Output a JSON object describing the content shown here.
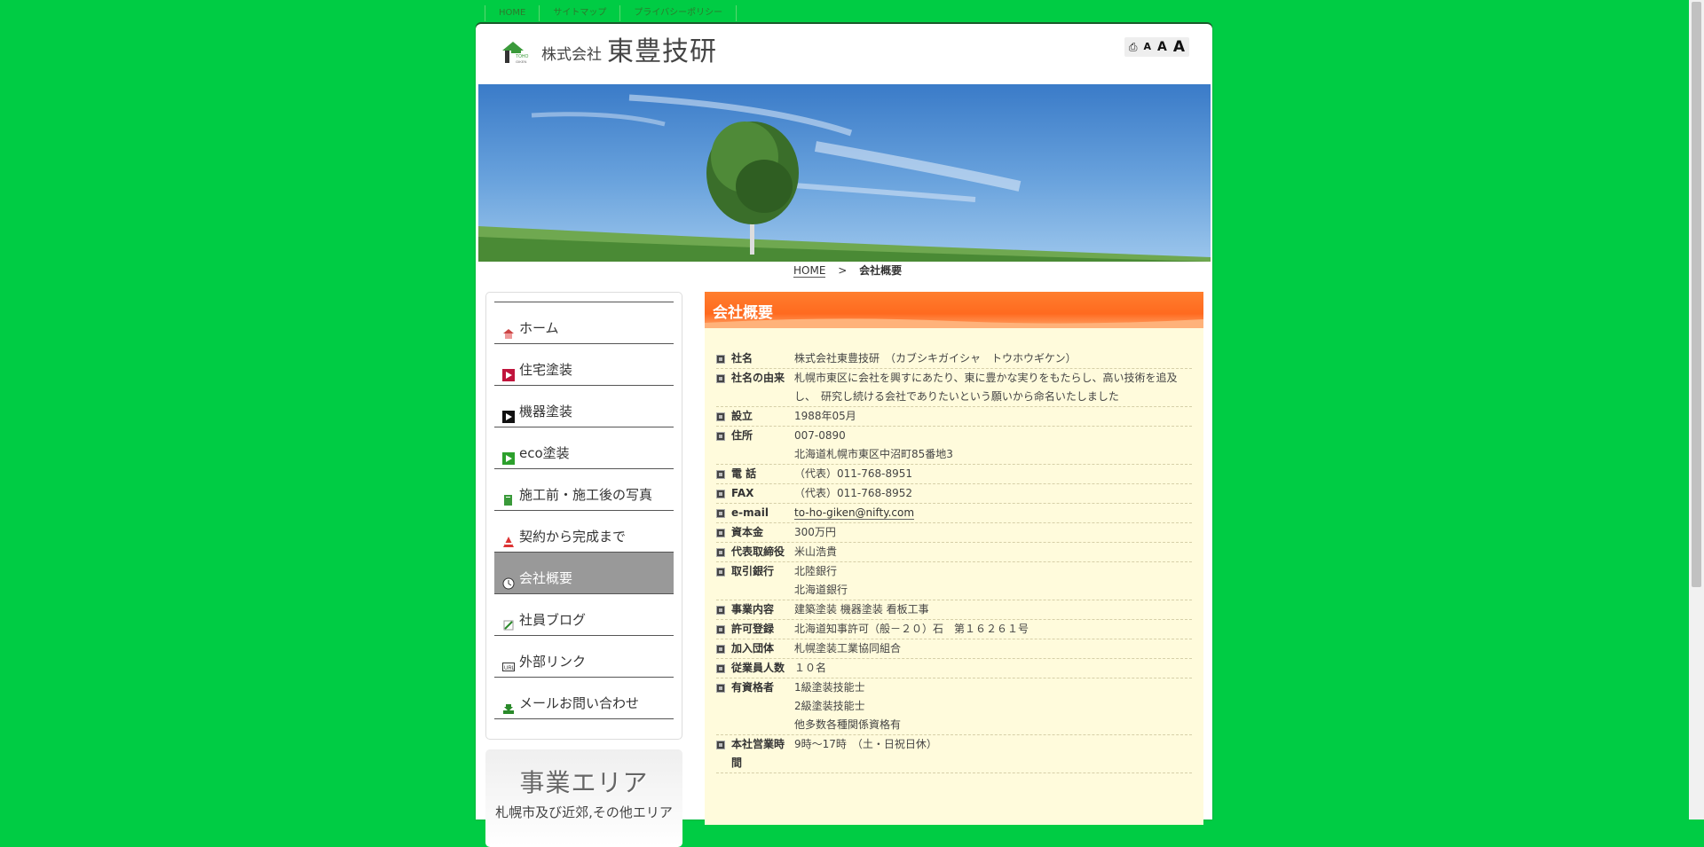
{
  "top_links": [
    "HOME",
    "サイトマップ",
    "プライバシーポリシー"
  ],
  "logo": {
    "prefix": "株式会社",
    "name": "東豊技研"
  },
  "font_size_controls": [
    "A",
    "A",
    "A"
  ],
  "breadcrumb": {
    "home": "HOME",
    "separator": ">",
    "current": "会社概要"
  },
  "nav": [
    {
      "label": "ホーム",
      "icon": "house-icon"
    },
    {
      "label": "住宅塗装",
      "icon": "play-icon"
    },
    {
      "label": "機器塗装",
      "icon": "play-icon"
    },
    {
      "label": "eco塗装",
      "icon": "play-icon"
    },
    {
      "label": "施工前・施工後の写真",
      "icon": "document-icon"
    },
    {
      "label": "契約から完成まで",
      "icon": "cone-icon"
    },
    {
      "label": "会社概要",
      "icon": "clock-icon",
      "active": true
    },
    {
      "label": "社員ブログ",
      "icon": "pencil-icon"
    },
    {
      "label": "外部リンク",
      "icon": "url-icon"
    },
    {
      "label": "メールお問い合わせ",
      "icon": "download-icon"
    }
  ],
  "area": {
    "title": "事業エリア",
    "subtitle": "札幌市及び近郊,その他エリア"
  },
  "page_title": "会社概要",
  "info": [
    {
      "key": "社名",
      "lines": [
        "株式会社東豊技研　（カブシキガイシャ　トウホウギケン）"
      ]
    },
    {
      "key": "社名の由来",
      "lines": [
        "札幌市東区に会社を興すにあたり、東に豊かな実りをもたらし、高い技術を追及し、　研究し続ける会社でありたいという願いから命名いたしました"
      ]
    },
    {
      "key": "設立",
      "lines": [
        "1988年05月"
      ]
    },
    {
      "key": "住所",
      "lines": [
        "007-0890",
        "北海道札幌市東区中沼町85番地3"
      ]
    },
    {
      "key": "電 話",
      "lines": [
        "（代表）011-768-8951"
      ]
    },
    {
      "key": "FAX",
      "lines": [
        "（代表）011-768-8952"
      ]
    },
    {
      "key": "e-mail",
      "lines": [
        "to-ho-giken@nifty.com"
      ],
      "link": true
    },
    {
      "key": "資本金",
      "lines": [
        "300万円"
      ]
    },
    {
      "key": "代表取締役",
      "lines": [
        "米山浩貴"
      ]
    },
    {
      "key": "取引銀行",
      "lines": [
        "北陸銀行",
        "北海道銀行"
      ]
    },
    {
      "key": "事業内容",
      "lines": [
        "建築塗装 機器塗装 看板工事"
      ]
    },
    {
      "key": "許可登録",
      "lines": [
        "北海道知事許可（般－２０）石　第１６２６１号"
      ]
    },
    {
      "key": "加入団体",
      "lines": [
        "札幌塗装工業協同組合"
      ]
    },
    {
      "key": "従業員人数",
      "lines": [
        "１０名"
      ]
    },
    {
      "key": "有資格者",
      "lines": [
        "1級塗装技能士",
        "2級塗装技能士",
        "他多数各種関係資格有"
      ]
    },
    {
      "key": "本社営業時間",
      "lines": [
        "9時～17時　（土・日祝日休）"
      ]
    }
  ],
  "colors": {
    "background": "#00cc44",
    "title_bar": "#ff6a1f",
    "content_bg": "#fffbdc"
  }
}
